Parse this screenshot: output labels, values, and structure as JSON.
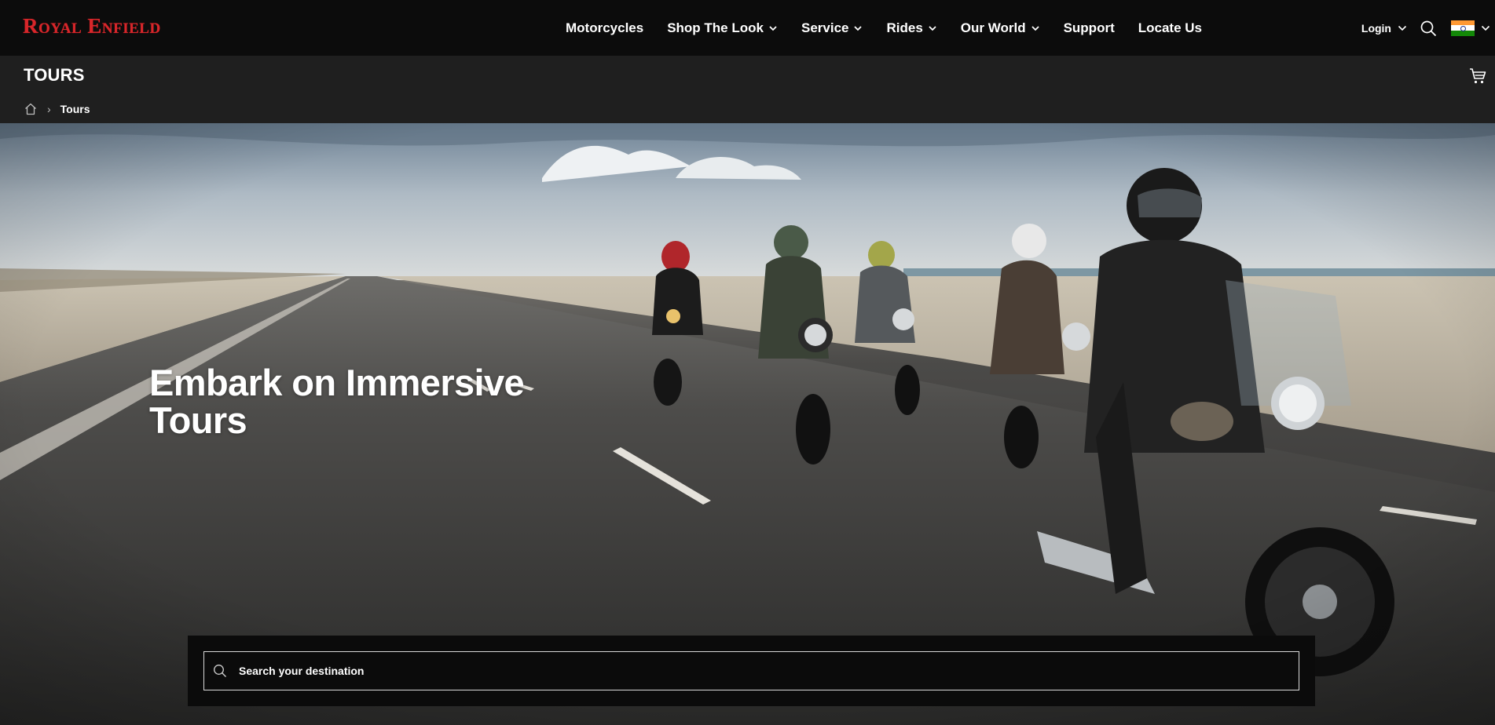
{
  "brand": {
    "logo_text": "Royal Enfield",
    "accent_color": "#d8262a"
  },
  "nav": {
    "items": [
      {
        "label": "Motorcycles",
        "has_dropdown": false
      },
      {
        "label": "Shop The Look",
        "has_dropdown": true
      },
      {
        "label": "Service",
        "has_dropdown": true
      },
      {
        "label": "Rides",
        "has_dropdown": true
      },
      {
        "label": "Our World",
        "has_dropdown": true
      },
      {
        "label": "Support",
        "has_dropdown": false
      },
      {
        "label": "Locate Us",
        "has_dropdown": false
      }
    ],
    "login_label": "Login",
    "icons": {
      "search": "search-icon",
      "flag": "india-flag-icon",
      "cart": "cart-icon",
      "home": "home-icon"
    }
  },
  "subheader": {
    "title": "TOURS",
    "breadcrumb": {
      "separator": "›",
      "current": "Tours"
    }
  },
  "hero": {
    "title_line1": "Embark on Immersive",
    "title_line2": "Tours"
  },
  "search": {
    "placeholder": "Search your destination",
    "value": ""
  }
}
